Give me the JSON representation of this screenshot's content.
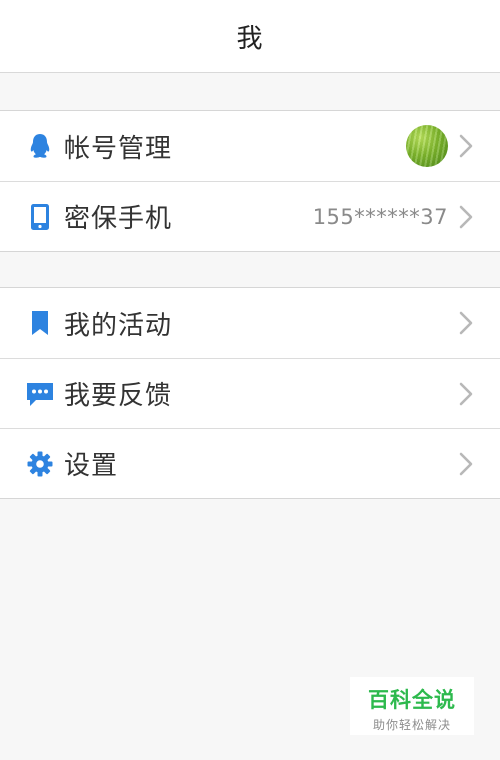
{
  "header": {
    "title": "我"
  },
  "account_group": {
    "items": [
      {
        "label": "帐号管理",
        "icon": "qq-penguin-icon"
      },
      {
        "label": "密保手机",
        "icon": "phone-icon",
        "value": "155******37"
      }
    ]
  },
  "more_group": {
    "items": [
      {
        "label": "我的活动",
        "icon": "bookmark-icon"
      },
      {
        "label": "我要反馈",
        "icon": "chat-bubble-icon"
      },
      {
        "label": "设置",
        "icon": "gear-icon"
      }
    ]
  },
  "watermark": {
    "title": "百科全说",
    "subtitle": "助你轻松解决"
  },
  "colors": {
    "accent": "#2d83e0",
    "chevron": "#b8b8b8",
    "background": "#f7f7f7",
    "watermark_green": "#2db94d"
  }
}
